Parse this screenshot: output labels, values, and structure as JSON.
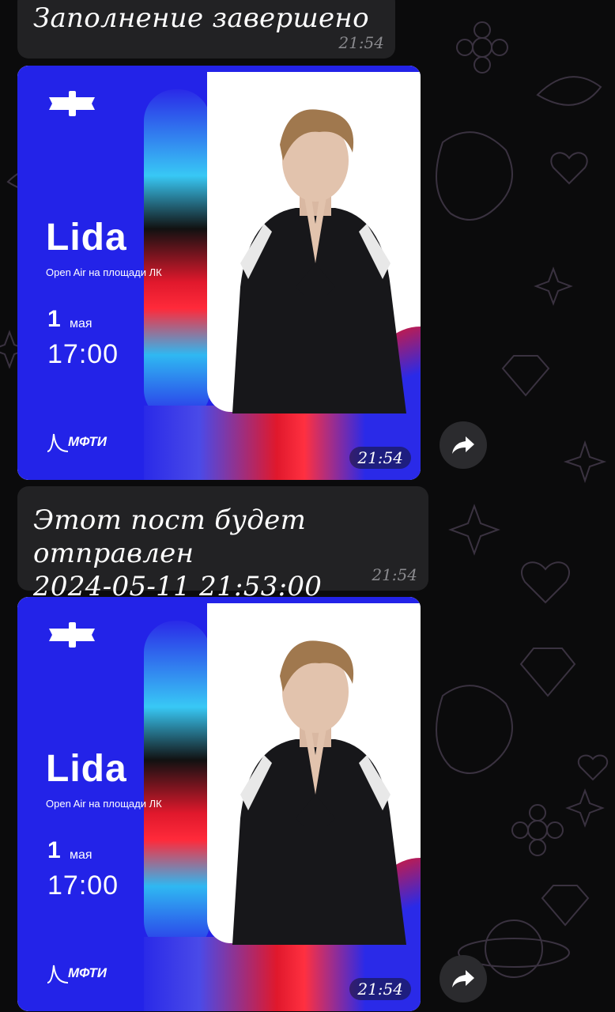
{
  "messages": [
    {
      "text": "Заполнение завершено",
      "time": "21:54"
    },
    {
      "text_line1": "Этот пост будет отправлен",
      "text_line2": "2024-05-11 21:53:00",
      "time": "21:54"
    }
  ],
  "photos": [
    {
      "time": "21:54",
      "poster": {
        "artist": "Lida",
        "subtitle": "Open Air на площади ЛК",
        "day": "1",
        "month": "мая",
        "time": "17:00",
        "brand": "МФТИ"
      }
    },
    {
      "time": "21:54",
      "poster": {
        "artist": "Lida",
        "subtitle": "Open Air на площади ЛК",
        "day": "1",
        "month": "мая",
        "time": "17:00",
        "brand": "МФТИ"
      }
    }
  ],
  "icons": {
    "share": "forward-arrow-icon",
    "logo": "mipt-logo-icon"
  },
  "colors": {
    "background": "#0b0b0c",
    "bubble": "#222224",
    "poster_blue": "#2323e8",
    "poster_red": "#e0182c"
  }
}
